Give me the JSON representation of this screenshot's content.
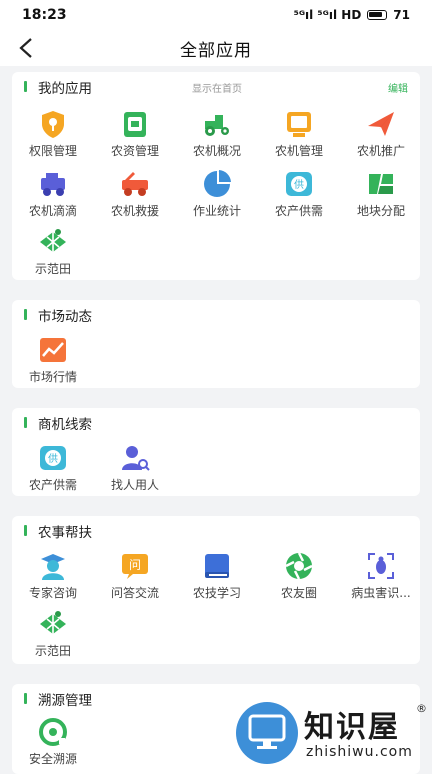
{
  "status": {
    "time": "18:23",
    "signal": "⁵ᴳıl ⁵ᴳıl HD",
    "battery": "71"
  },
  "nav": {
    "title": "全部应用"
  },
  "sections": {
    "my_apps": {
      "title": "我的应用",
      "hint": "显示在首页",
      "edit": "编辑",
      "items": [
        {
          "label": "权限管理",
          "icon": "permission-icon"
        },
        {
          "label": "农资管理",
          "icon": "supplies-icon"
        },
        {
          "label": "农机概况",
          "icon": "tractor-icon"
        },
        {
          "label": "农机管理",
          "icon": "machine-manage-icon"
        },
        {
          "label": "农机推广",
          "icon": "promote-icon"
        },
        {
          "label": "农机滴滴",
          "icon": "machine-hail-icon"
        },
        {
          "label": "农机救援",
          "icon": "rescue-truck-icon"
        },
        {
          "label": "作业统计",
          "icon": "pie-chart-icon"
        },
        {
          "label": "农产供需",
          "icon": "supply-demand-icon"
        },
        {
          "label": "地块分配",
          "icon": "land-plot-icon"
        },
        {
          "label": "示范田",
          "icon": "demo-field-icon"
        }
      ]
    },
    "market": {
      "title": "市场动态",
      "items": [
        {
          "label": "市场行情",
          "icon": "trend-icon"
        }
      ]
    },
    "business": {
      "title": "商机线索",
      "items": [
        {
          "label": "农产供需",
          "icon": "supply-demand-icon"
        },
        {
          "label": "找人用人",
          "icon": "find-person-icon"
        }
      ]
    },
    "farming": {
      "title": "农事帮扶",
      "items": [
        {
          "label": "专家咨询",
          "icon": "expert-icon"
        },
        {
          "label": "问答交流",
          "icon": "qa-icon"
        },
        {
          "label": "农技学习",
          "icon": "book-icon"
        },
        {
          "label": "农友圈",
          "icon": "circle-icon"
        },
        {
          "label": "病虫害识...",
          "icon": "pest-scan-icon"
        },
        {
          "label": "示范田",
          "icon": "demo-field-icon"
        }
      ]
    },
    "trace": {
      "title": "溯源管理",
      "items": [
        {
          "label": "安全溯源",
          "icon": "trace-icon"
        }
      ]
    }
  },
  "watermark": {
    "brand": "知识屋",
    "site": "zhishiwu.com",
    "reg": "®",
    "mark": "?"
  },
  "colors": {
    "accent": "#34b35a",
    "orange": "#f5a623",
    "blue": "#3d8fd8"
  }
}
